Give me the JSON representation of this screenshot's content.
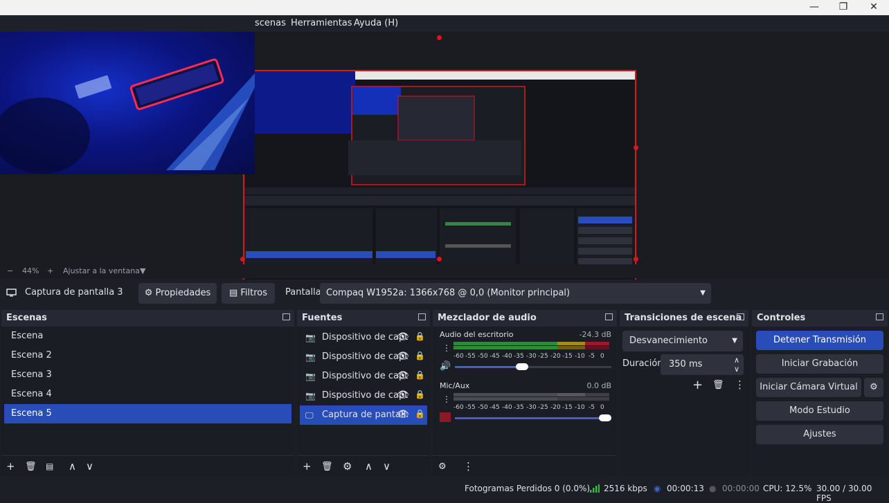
{
  "window": {
    "minimize": "—",
    "maximize": "❐",
    "close": "✕"
  },
  "menu": {
    "escenas": "scenas",
    "herramientas": "Herramientas",
    "ayuda": "Ayuda (H)"
  },
  "zoom": {
    "minus": "−",
    "level": "44%",
    "plus": "+",
    "fit": "Ajustar a la ventana",
    "caret": "▼"
  },
  "source_toolbar": {
    "icon": "monitor-icon",
    "source_name": "Captura de pantalla 3",
    "props": "Propiedades",
    "filters": "Filtros",
    "display_label": "Pantalla",
    "display_value": "Compaq W1952a: 1366x768 @ 0,0 (Monitor principal)"
  },
  "scenes": {
    "title": "Escenas",
    "items": [
      "Escena",
      "Escena 2",
      "Escena 3",
      "Escena 4",
      "Escena 5"
    ],
    "selected": 4
  },
  "sources": {
    "title": "Fuentes",
    "items": [
      {
        "name": "Dispositivo de capt",
        "icon": "camera-icon"
      },
      {
        "name": "Dispositivo de capt",
        "icon": "camera-icon"
      },
      {
        "name": "Dispositivo de capt",
        "icon": "camera-icon"
      },
      {
        "name": "Dispositivo de capt",
        "icon": "camera-icon"
      },
      {
        "name": "Captura de pantall:",
        "icon": "monitor-icon"
      }
    ],
    "selected": 4
  },
  "mixer": {
    "title": "Mezclador de audio",
    "channels": [
      {
        "name": "Audio del escritorio",
        "db": "-24.3 dB",
        "level": 0.45,
        "volume": 0.55
      },
      {
        "name": "Mic/Aux",
        "db": "0.0 dB",
        "level": 0.0,
        "volume": 1.0
      }
    ],
    "ticks": [
      "-60",
      "-55",
      "-50",
      "-45",
      "-40",
      "-35",
      "-30",
      "-25",
      "-20",
      "-15",
      "-10",
      "-5",
      "0"
    ]
  },
  "transitions": {
    "title": "Transiciones de escena",
    "type": "Desvanecimiento",
    "duration_label": "Duración",
    "duration_value": "350 ms"
  },
  "controls": {
    "title": "Controles",
    "stop_stream": "Detener Transmisión",
    "start_rec": "Iniciar Grabación",
    "virtual_cam": "Iniciar Cámara Virtual",
    "studio": "Modo Estudio",
    "settings": "Ajustes"
  },
  "status": {
    "dropped": "Fotogramas Perdidos 0 (0.0%)",
    "bitrate": "2516 kbps",
    "stream_time": "00:00:13",
    "rec_time": "00:00:00",
    "cpu": "CPU: 12.5%",
    "fps": "30.00 / 30.00 FPS"
  },
  "colors": {
    "accent": "#284cb8",
    "selection": "#e0141e",
    "meter_green": "#2c8c3a",
    "meter_yellow": "#a58a1e",
    "meter_red": "#9a1a28"
  }
}
